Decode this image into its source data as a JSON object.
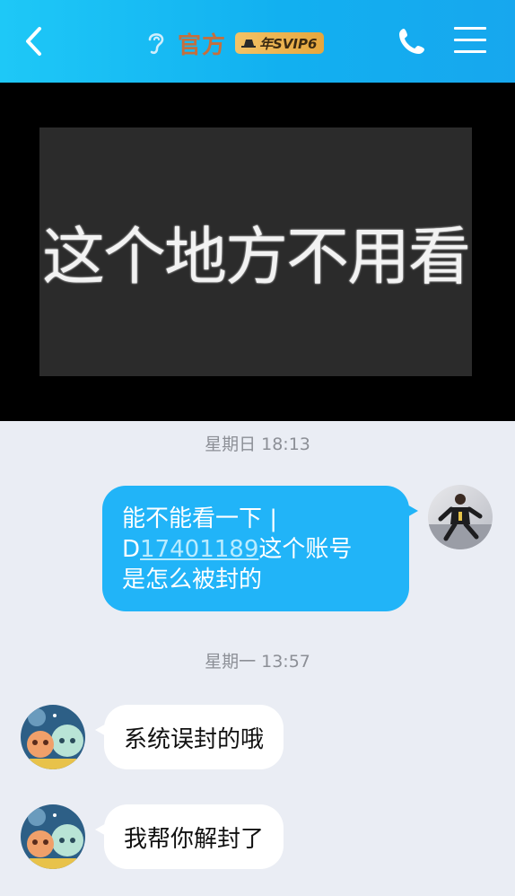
{
  "header": {
    "title": "官方",
    "badge": "年SVIP6",
    "icons": {
      "back": "chevron-left-icon",
      "ear": "ear-icon",
      "phone": "phone-icon",
      "menu": "menu-icon"
    },
    "colors": {
      "bar": "#17b3f2",
      "title": "#c46f3e",
      "badge": "#e8ad4a"
    }
  },
  "overlay": {
    "text": "这个地方不用看"
  },
  "chat": {
    "timestamp_1": "星期日 18:13",
    "timestamp_2": "星期一 13:57",
    "outgoing": {
      "line1": "能不能看一下 |",
      "line2_prefix": "D",
      "line2_link": "17401189",
      "line2_suffix": "这个账号",
      "line3": "是怎么被封的"
    },
    "incoming_1": "系统误封的哦",
    "incoming_2": "我帮你解封了",
    "colors": {
      "outgoing_bubble": "#21b4f8",
      "incoming_bubble": "#ffffff",
      "background": "#eaedf4"
    }
  }
}
